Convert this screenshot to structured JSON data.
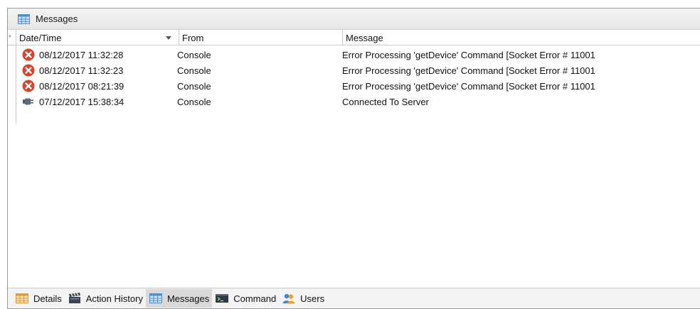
{
  "window": {
    "title": "Messages"
  },
  "grid": {
    "columns": [
      {
        "label": "Date/Time",
        "sorted": "descending"
      },
      {
        "label": "From"
      },
      {
        "label": "Message"
      }
    ],
    "new_row_indicator": "*",
    "rows": [
      {
        "status_icon": "error-icon",
        "datetime": "08/12/2017 11:32:28",
        "from": "Console",
        "message": "Error Processing 'getDevice' Command [Socket Error # 11001"
      },
      {
        "status_icon": "error-icon",
        "datetime": "08/12/2017 11:32:23",
        "from": "Console",
        "message": "Error Processing 'getDevice' Command [Socket Error # 11001"
      },
      {
        "status_icon": "error-icon",
        "datetime": "08/12/2017 08:21:39",
        "from": "Console",
        "message": "Error Processing 'getDevice' Command [Socket Error # 11001"
      },
      {
        "status_icon": "plug-icon",
        "datetime": "07/12/2017 15:38:34",
        "from": "Console",
        "message": "Connected To Server"
      }
    ]
  },
  "tabs": [
    {
      "label": "Details",
      "icon": "grid-icon",
      "active": false
    },
    {
      "label": "Action History",
      "icon": "clapperboard-icon",
      "active": false
    },
    {
      "label": "Messages",
      "icon": "grid-icon",
      "active": true
    },
    {
      "label": "Command",
      "icon": "terminal-icon",
      "active": false
    },
    {
      "label": "Users",
      "icon": "users-icon",
      "active": false
    }
  ],
  "colors": {
    "error_red": "#d9432b",
    "grid_icon_blue": "#5aa0dc",
    "active_tab": "#d9d9d9"
  }
}
